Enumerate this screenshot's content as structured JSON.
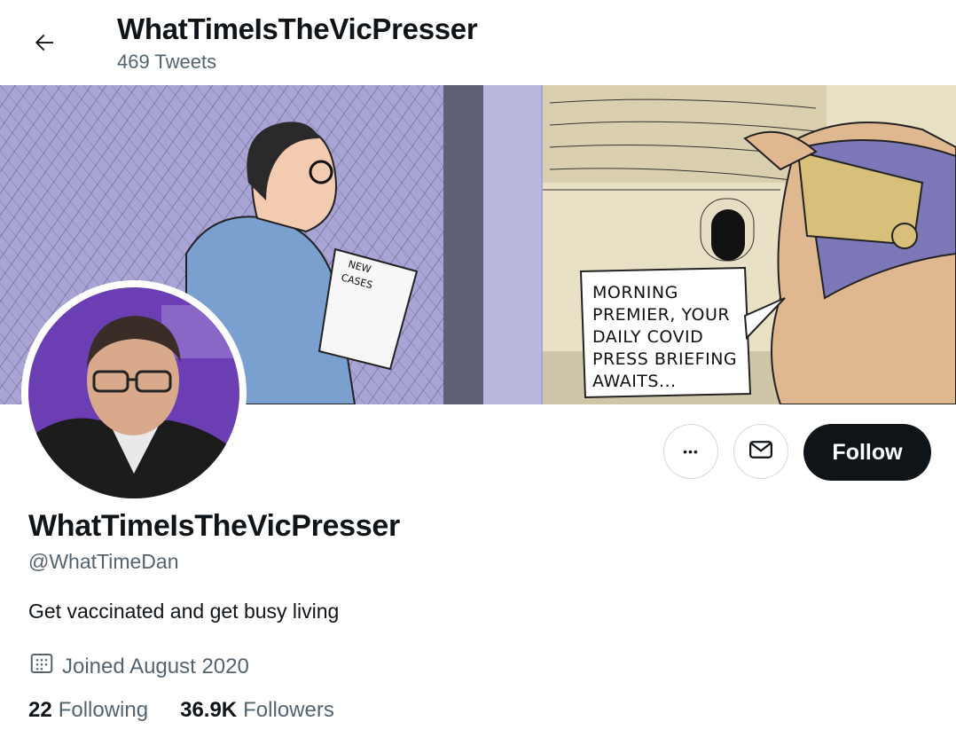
{
  "header": {
    "title": "WhatTimeIsTheVicPresser",
    "tweet_count": "469 Tweets"
  },
  "banner": {
    "paper_line1": "NEW",
    "paper_line2": "CASES",
    "bubble_lines": [
      "MORNING",
      "PREMIER, YOUR",
      "DAILY COVID",
      "PRESS BRIEFING",
      "AWAITS..."
    ]
  },
  "actions": {
    "more_label": "•••",
    "follow_label": "Follow"
  },
  "profile": {
    "display_name": "WhatTimeIsTheVicPresser",
    "handle": "@WhatTimeDan",
    "bio": "Get vaccinated and get busy living",
    "joined": "Joined August 2020",
    "following_count": "22",
    "following_label": "Following",
    "followers_count": "36.9K",
    "followers_label": "Followers"
  },
  "colors": {
    "text_primary": "#0f1419",
    "text_secondary": "#536471",
    "border": "#cfd9de"
  }
}
